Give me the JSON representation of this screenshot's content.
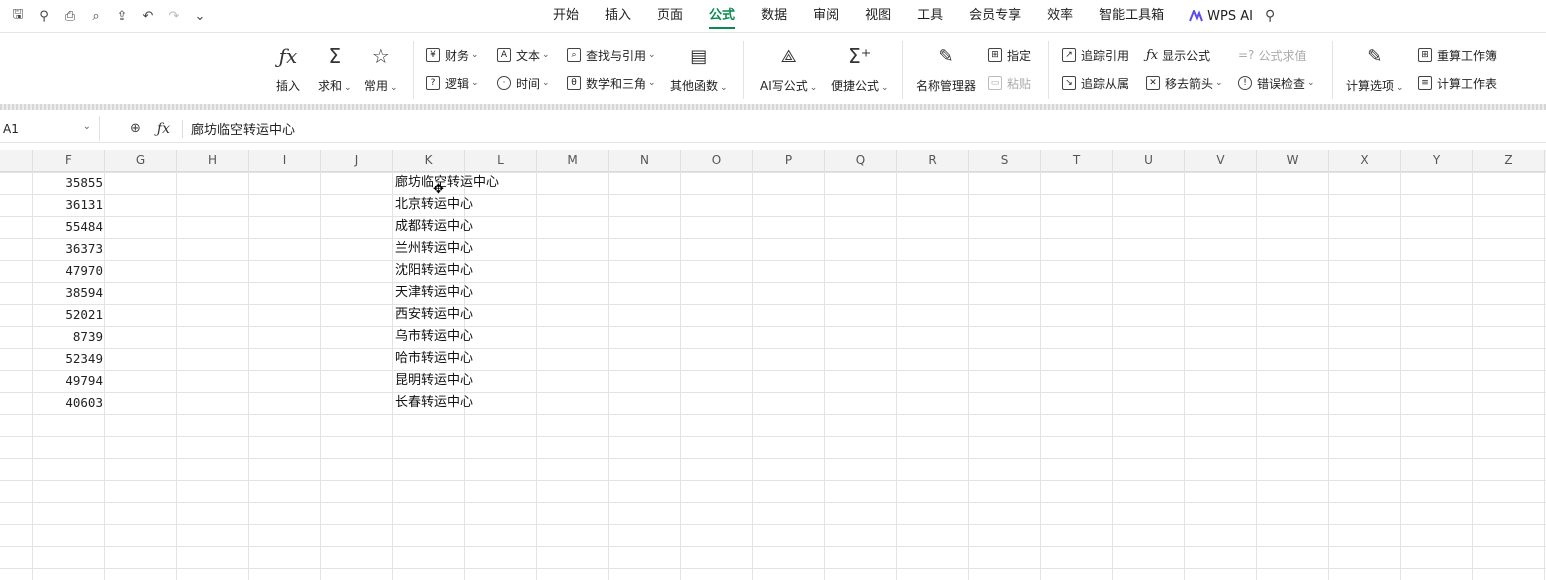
{
  "tabs": [
    "开始",
    "插入",
    "页面",
    "公式",
    "数据",
    "审阅",
    "视图",
    "工具",
    "会员专享",
    "效率",
    "智能工具箱"
  ],
  "active_tab": "公式",
  "wps_ai_label": "WPS AI",
  "ribbon": {
    "insert_label": "插入",
    "sum_label": "求和",
    "common_label": "常用",
    "finance_label": "财务",
    "text_label": "文本",
    "lookup_label": "查找与引用",
    "logic_label": "逻辑",
    "time_label": "时间",
    "math_label": "数学和三角",
    "other_label": "其他函数",
    "ai_formula_label": "AI写公式",
    "quick_formula_label": "便捷公式",
    "name_manager_label": "名称管理器",
    "specify_label": "指定",
    "paste_label": "粘贴",
    "trace_precedents_label": "追踪引用",
    "trace_dependents_label": "追踪从属",
    "show_formula_label": "显示公式",
    "remove_arrows_label": "移去箭头",
    "eval_formula_label": "公式求值",
    "error_check_label": "错误检查",
    "calc_options_label": "计算选项",
    "recalc_book_label": "重算工作簿",
    "calc_sheet_label": "计算工作表"
  },
  "formula_bar": {
    "name_box": "A1",
    "content": "廊坊临空转运中心"
  },
  "columns": [
    "F",
    "G",
    "H",
    "I",
    "J",
    "K",
    "L",
    "M",
    "N",
    "O",
    "P",
    "Q",
    "R",
    "S",
    "T",
    "U",
    "V",
    "W",
    "X",
    "Y",
    "Z"
  ],
  "rows": [
    {
      "num": "35855",
      "text": "廊坊临空转运中心"
    },
    {
      "num": "36131",
      "text": "北京转运中心"
    },
    {
      "num": "55484",
      "text": "成都转运中心"
    },
    {
      "num": "36373",
      "text": "兰州转运中心"
    },
    {
      "num": "47970",
      "text": "沈阳转运中心"
    },
    {
      "num": "38594",
      "text": "天津转运中心"
    },
    {
      "num": "52021",
      "text": "西安转运中心"
    },
    {
      "num": "8739",
      "text": "乌市转运中心"
    },
    {
      "num": "52349",
      "text": "哈市转运中心"
    },
    {
      "num": "49794",
      "text": "昆明转运中心"
    },
    {
      "num": "40603",
      "text": "长春转运中心"
    }
  ]
}
